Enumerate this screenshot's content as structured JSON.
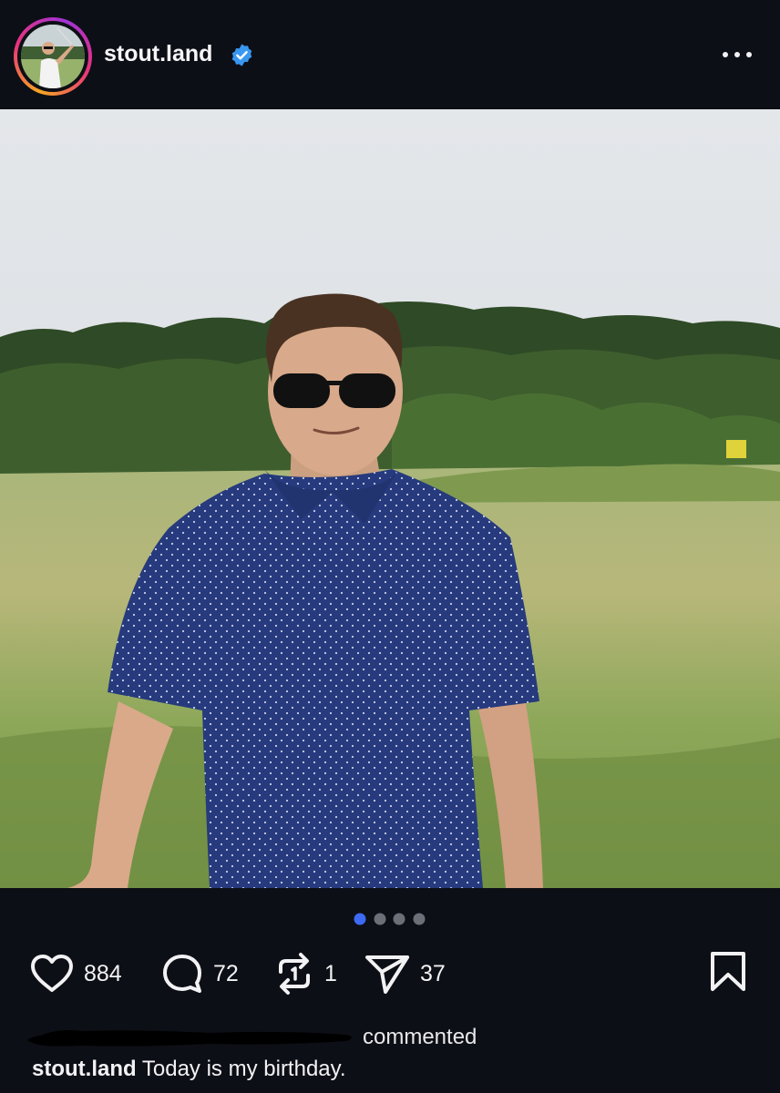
{
  "post": {
    "username": "stout.land",
    "verified": true,
    "carousel": {
      "total": 4,
      "active": 1
    }
  },
  "actions": {
    "likes": "884",
    "comments": "72",
    "reposts": "1",
    "shares": "37"
  },
  "activity": {
    "text": "commented"
  },
  "caption": {
    "username": "stout.land",
    "text": "Today is my birthday."
  },
  "icons": {
    "like": "heart-icon",
    "comment": "comment-bubble-icon",
    "repost": "repost-icon",
    "share": "paper-plane-icon",
    "save": "bookmark-icon",
    "more": "more-horizontal-icon",
    "verified": "verified-badge-icon"
  },
  "colors": {
    "background": "#0d0f16",
    "verified": "#3897f0",
    "carousel_active": "#3d6af2",
    "carousel_inactive": "#6c6f78"
  }
}
